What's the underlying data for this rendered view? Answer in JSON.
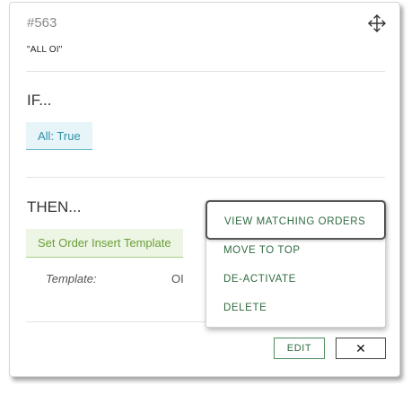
{
  "rule": {
    "id": "#563",
    "name": "\"ALL OI\""
  },
  "conditions": {
    "heading": "IF...",
    "chip": "All: True"
  },
  "actions": {
    "heading": "THEN...",
    "chip": "Set Order Insert Template",
    "field_label": "Template:",
    "field_value": "OI"
  },
  "footer": {
    "edit_label": "EDIT",
    "close_label": "✕"
  },
  "menu": {
    "items": [
      {
        "label": "VIEW MATCHING ORDERS"
      },
      {
        "label": "MOVE TO TOP"
      },
      {
        "label": "DE-ACTIVATE"
      },
      {
        "label": "DELETE"
      }
    ]
  },
  "colors": {
    "condition_accent": "#2e8fa8",
    "action_accent": "#6a9f3a",
    "menu_text": "#2f6b3f"
  },
  "icons": {
    "drag": "move-arrows-icon"
  }
}
